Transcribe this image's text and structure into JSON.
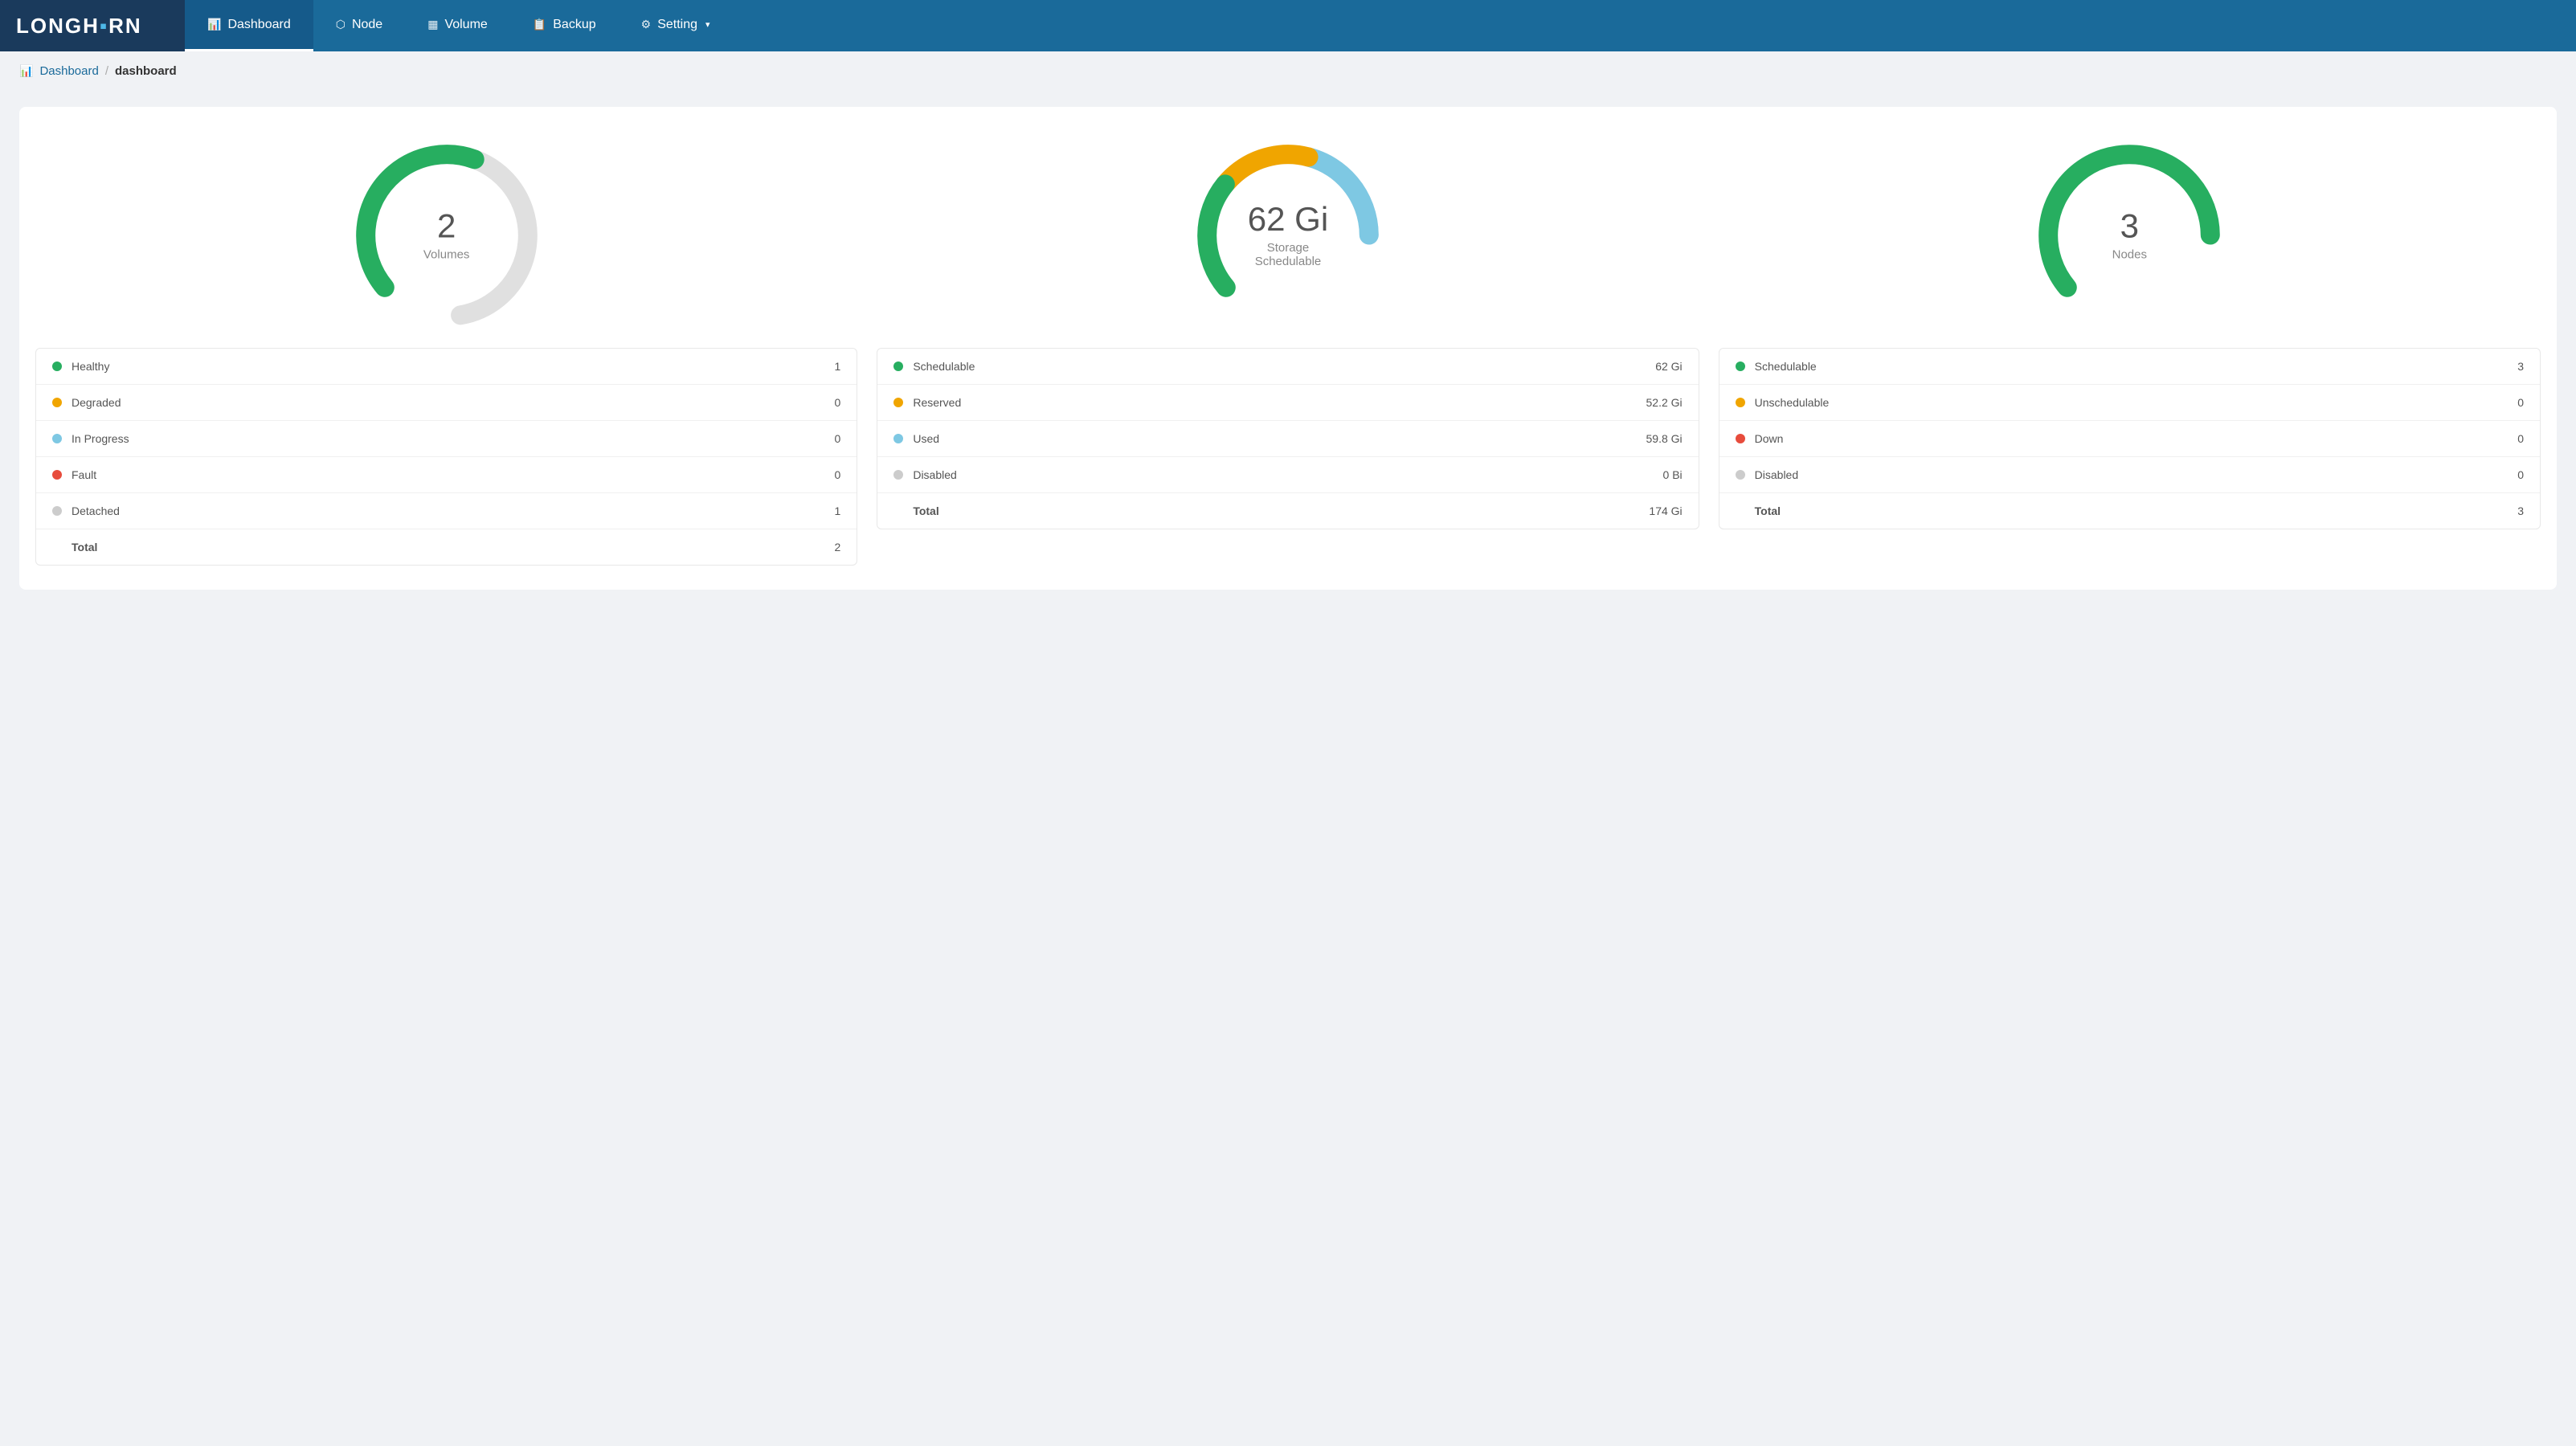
{
  "app": {
    "logo": "LONGH",
    "logo_highlight": "O",
    "logo_end": "RN"
  },
  "nav": {
    "items": [
      {
        "id": "dashboard",
        "label": "Dashboard",
        "icon": "📊",
        "active": true
      },
      {
        "id": "node",
        "label": "Node",
        "icon": "🖧",
        "active": false
      },
      {
        "id": "volume",
        "label": "Volume",
        "icon": "🗂",
        "active": false
      },
      {
        "id": "backup",
        "label": "Backup",
        "icon": "📄",
        "active": false
      },
      {
        "id": "setting",
        "label": "Setting",
        "icon": "⚙",
        "active": false,
        "arrow": "▾"
      }
    ]
  },
  "breadcrumb": {
    "icon": "📊",
    "parent": "Dashboard",
    "separator": "/",
    "current": "dashboard"
  },
  "panels": {
    "volumes": {
      "value": "2",
      "subtitle": "Volumes",
      "donut": {
        "segments": [
          {
            "label": "healthy",
            "color": "#27ae60",
            "pct": 50
          },
          {
            "label": "rest",
            "color": "#e0e0e0",
            "pct": 50
          }
        ]
      },
      "stats": [
        {
          "label": "Healthy",
          "value": "1",
          "color": "#27ae60"
        },
        {
          "label": "Degraded",
          "value": "0",
          "color": "#f0a500"
        },
        {
          "label": "In Progress",
          "value": "0",
          "color": "#7ec8e3"
        },
        {
          "label": "Fault",
          "value": "0",
          "color": "#e74c3c"
        },
        {
          "label": "Detached",
          "value": "1",
          "color": "#ccc"
        },
        {
          "label": "Total",
          "value": "2",
          "color": null
        }
      ]
    },
    "storage": {
      "value": "62 Gi",
      "subtitle": "Storage Schedulable",
      "donut": {
        "segments": [
          {
            "label": "schedulable",
            "color": "#27ae60",
            "pct": 36
          },
          {
            "label": "reserved",
            "color": "#f0a500",
            "pct": 30
          },
          {
            "label": "used",
            "color": "#7ec8e3",
            "pct": 34
          }
        ]
      },
      "stats": [
        {
          "label": "Schedulable",
          "value": "62 Gi",
          "color": "#27ae60"
        },
        {
          "label": "Reserved",
          "value": "52.2 Gi",
          "color": "#f0a500"
        },
        {
          "label": "Used",
          "value": "59.8 Gi",
          "color": "#7ec8e3"
        },
        {
          "label": "Disabled",
          "value": "0 Bi",
          "color": "#ccc"
        },
        {
          "label": "Total",
          "value": "174 Gi",
          "color": null
        }
      ]
    },
    "nodes": {
      "value": "3",
      "subtitle": "Nodes",
      "donut": {
        "segments": [
          {
            "label": "schedulable",
            "color": "#27ae60",
            "pct": 100
          }
        ]
      },
      "stats": [
        {
          "label": "Schedulable",
          "value": "3",
          "color": "#27ae60"
        },
        {
          "label": "Unschedulable",
          "value": "0",
          "color": "#f0a500"
        },
        {
          "label": "Down",
          "value": "0",
          "color": "#e74c3c"
        },
        {
          "label": "Disabled",
          "value": "0",
          "color": "#ccc"
        },
        {
          "label": "Total",
          "value": "3",
          "color": null
        }
      ]
    }
  }
}
